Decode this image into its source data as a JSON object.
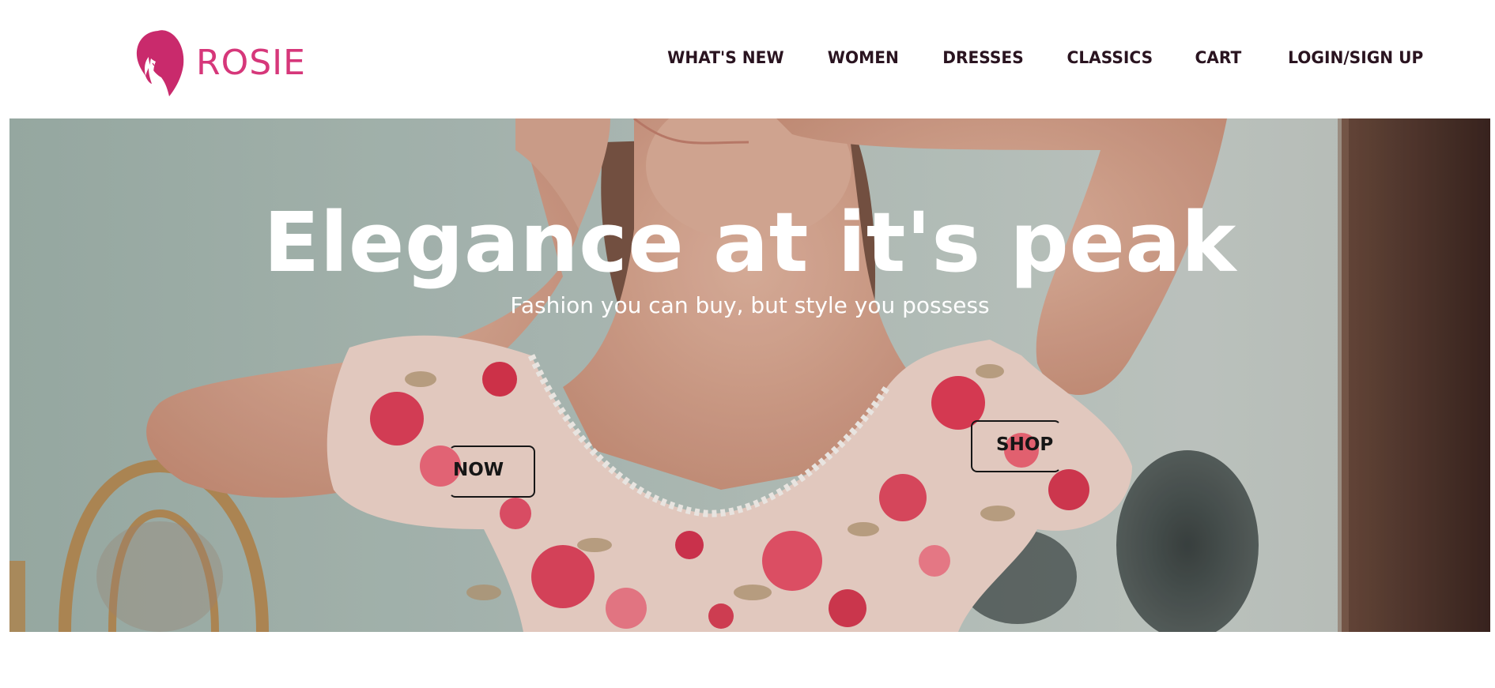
{
  "brand": {
    "name": "ROSIE",
    "color": "#d6377a"
  },
  "nav": {
    "items": [
      {
        "label": "WHAT'S NEW"
      },
      {
        "label": "WOMEN"
      },
      {
        "label": "DRESSES"
      },
      {
        "label": "CLASSICS"
      },
      {
        "label": "CART"
      },
      {
        "label": "LOGIN/SIGN UP"
      }
    ]
  },
  "hero": {
    "title": "Elegance at it's peak",
    "subtitle": "Fashion you can buy, but style you possess",
    "cta_left": "NOW",
    "cta_right": "SHOP",
    "image_icon": "woman-in-floral-dress-photo"
  },
  "colors": {
    "nav_text": "#2a1420",
    "hero_text": "#ffffff",
    "cta_text": "#161616"
  }
}
